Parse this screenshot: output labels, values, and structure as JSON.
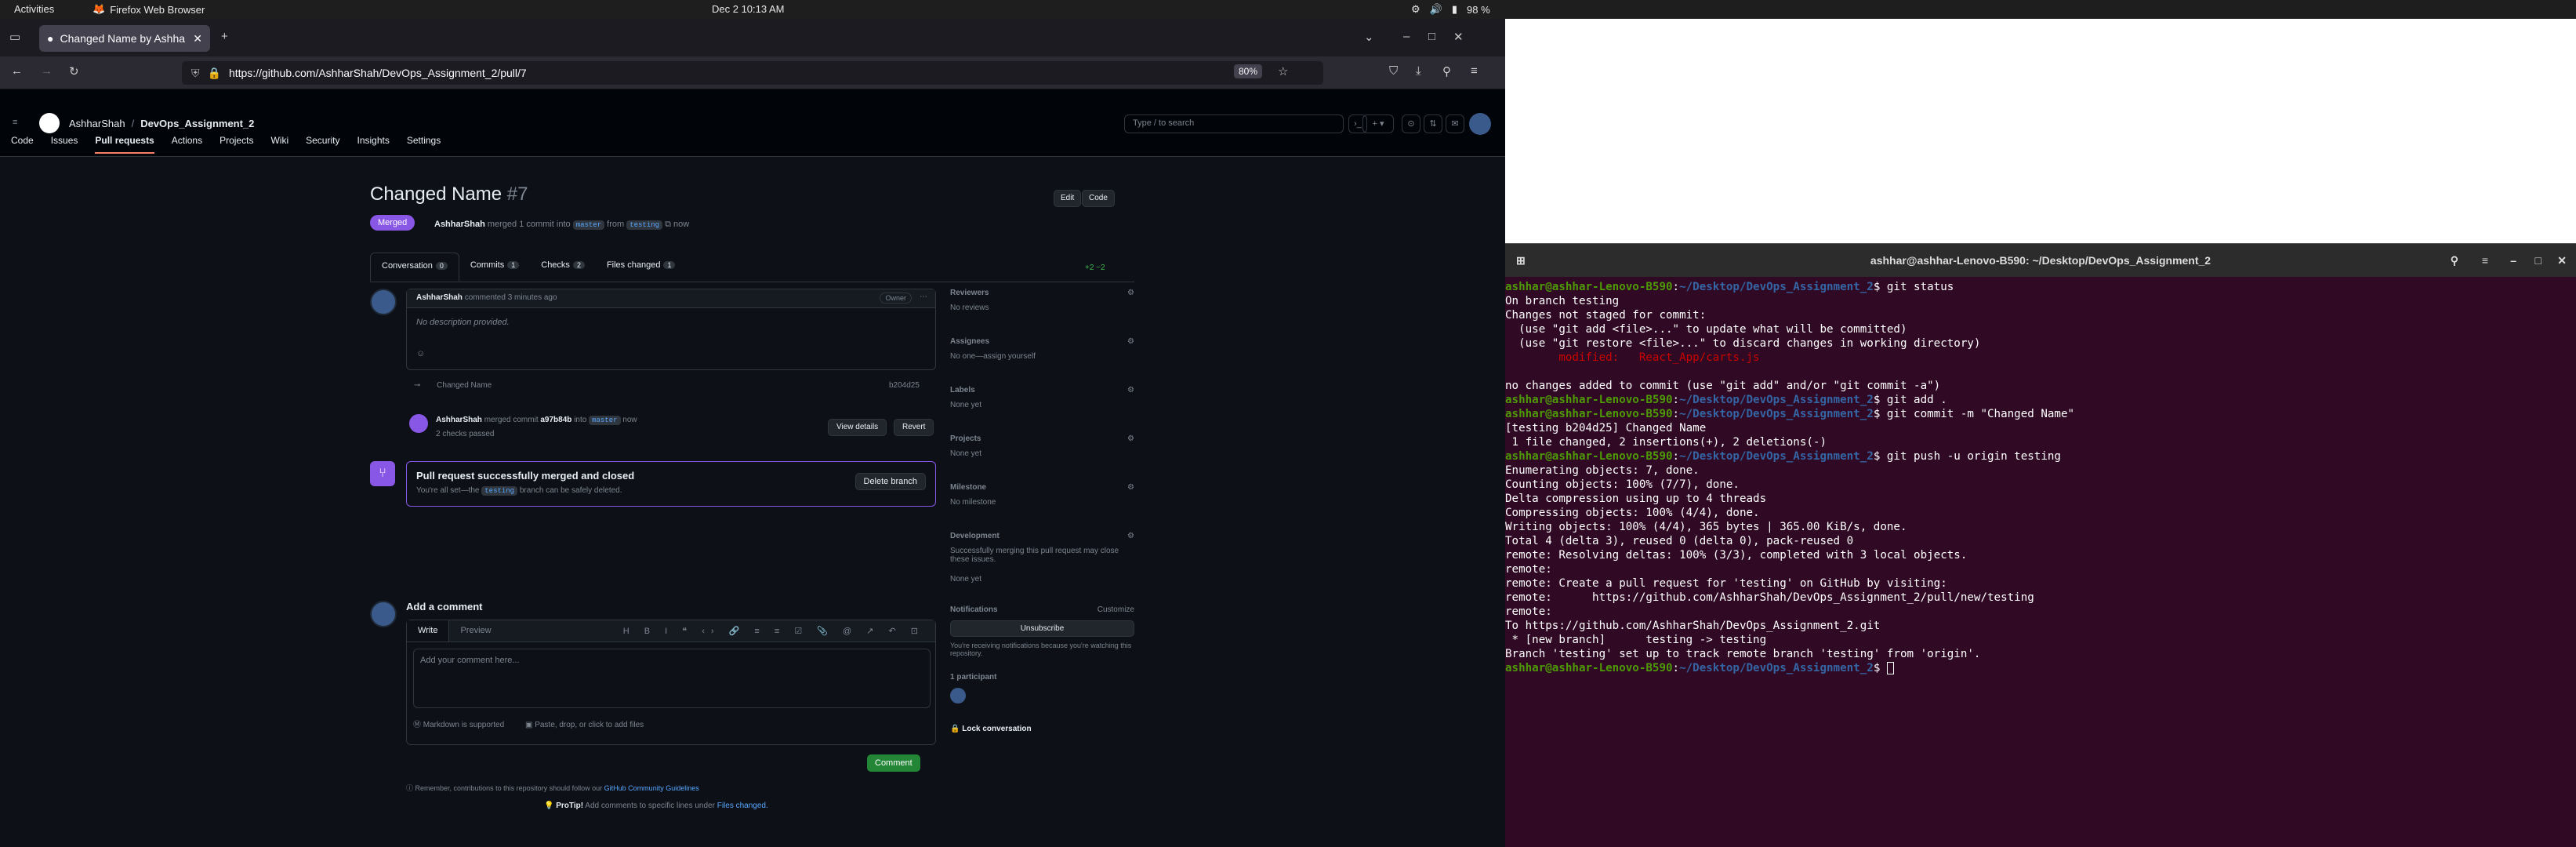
{
  "topbar": {
    "activities": "Activities",
    "app": "Firefox Web Browser",
    "clock": "Dec 2  10:13 AM",
    "battery": "98 %"
  },
  "browser": {
    "tab_title": "Changed Name by Ashha",
    "url": "https://github.com/AshharShah/DevOps_Assignment_2/pull/7",
    "zoom": "80%"
  },
  "gh": {
    "owner": "AshharShah",
    "repo": "DevOps_Assignment_2",
    "search_placeholder": "Type / to search",
    "nav": [
      "Code",
      "Issues",
      "Pull requests",
      "Actions",
      "Projects",
      "Wiki",
      "Security",
      "Insights",
      "Settings"
    ],
    "pr_title": "Changed Name",
    "pr_num": "#7",
    "edit": "Edit",
    "code_btn": "Code",
    "state": "Merged",
    "meta_user": "AshharShah",
    "meta_text": "merged 1 commit into",
    "base": "master",
    "meta_from": "from",
    "head": "testing",
    "meta_when": "now",
    "tabs": [
      {
        "label": "Conversation",
        "count": "0"
      },
      {
        "label": "Commits",
        "count": "1"
      },
      {
        "label": "Checks",
        "count": "2"
      },
      {
        "label": "Files changed",
        "count": "1"
      }
    ],
    "diffstat": "+2 −2",
    "comment_user": "AshharShah",
    "comment_when": "commented 3 minutes ago",
    "owner_badge": "Owner",
    "comment_body": "No description provided.",
    "commit_msg": "Changed Name",
    "commit_sha": "b204d25",
    "merge_event_user": "AshharShah",
    "merge_event_text": "merged commit",
    "merge_sha": "a97b84b",
    "merge_into": "into",
    "merge_base": "master",
    "merge_when": "now",
    "checks": "2 checks passed",
    "view_details": "View details",
    "revert": "Revert",
    "merged_title": "Pull request successfully merged and closed",
    "merged_sub": "You're all set—the",
    "merged_branch": "testing",
    "merged_sub2": "branch can be safely deleted.",
    "delete_branch": "Delete branch",
    "add_comment": "Add a comment",
    "write": "Write",
    "preview": "Preview",
    "comment_placeholder": "Add your comment here...",
    "markdown": "Markdown is supported",
    "paste": "Paste, drop, or click to add files",
    "comment_btn": "Comment",
    "reminder": "Remember, contributions to this repository should follow our",
    "guidelines": "GitHub Community Guidelines",
    "protip": "ProTip!",
    "protip_text": "Add comments to specific lines under",
    "files_changed": "Files changed.",
    "side": {
      "reviewers": "Reviewers",
      "no_reviews": "No reviews",
      "assignees": "Assignees",
      "no_one": "No one—assign yourself",
      "labels": "Labels",
      "none_yet": "None yet",
      "projects": "Projects",
      "milestone": "Milestone",
      "no_milestone": "No milestone",
      "development": "Development",
      "dev_text": "Successfully merging this pull request may close these issues.",
      "notifications": "Notifications",
      "customize": "Customize",
      "unsubscribe": "Unsubscribe",
      "notif_text": "You're receiving notifications because you're watching this repository.",
      "participants": "1 participant",
      "lock": "Lock conversation"
    }
  },
  "terminal": {
    "title": "ashhar@ashhar-Lenovo-B590: ~/Desktop/DevOps_Assignment_2",
    "user": "ashhar@ashhar-Lenovo-B590",
    "path": "~/Desktop/DevOps_Assignment_2",
    "lines": [
      {
        "p": true,
        "cmd": "git status"
      },
      {
        "t": "On branch testing"
      },
      {
        "t": "Changes not staged for commit:"
      },
      {
        "t": "  (use \"git add <file>...\" to update what will be committed)"
      },
      {
        "t": "  (use \"git restore <file>...\" to discard changes in working directory)"
      },
      {
        "t": "\tmodified:   React_App/carts.js",
        "red": true
      },
      {
        "t": ""
      },
      {
        "t": "no changes added to commit (use \"git add\" and/or \"git commit -a\")"
      },
      {
        "p": true,
        "cmd": "git add ."
      },
      {
        "p": true,
        "cmd": "git commit -m \"Changed Name\""
      },
      {
        "t": "[testing b204d25] Changed Name"
      },
      {
        "t": " 1 file changed, 2 insertions(+), 2 deletions(-)"
      },
      {
        "p": true,
        "cmd": "git push -u origin testing"
      },
      {
        "t": "Enumerating objects: 7, done."
      },
      {
        "t": "Counting objects: 100% (7/7), done."
      },
      {
        "t": "Delta compression using up to 4 threads"
      },
      {
        "t": "Compressing objects: 100% (4/4), done."
      },
      {
        "t": "Writing objects: 100% (4/4), 365 bytes | 365.00 KiB/s, done."
      },
      {
        "t": "Total 4 (delta 3), reused 0 (delta 0), pack-reused 0"
      },
      {
        "t": "remote: Resolving deltas: 100% (3/3), completed with 3 local objects."
      },
      {
        "t": "remote:"
      },
      {
        "t": "remote: Create a pull request for 'testing' on GitHub by visiting:"
      },
      {
        "t": "remote:      https://github.com/AshharShah/DevOps_Assignment_2/pull/new/testing"
      },
      {
        "t": "remote:"
      },
      {
        "t": "To https://github.com/AshharShah/DevOps_Assignment_2.git"
      },
      {
        "t": " * [new branch]      testing -> testing"
      },
      {
        "t": "Branch 'testing' set up to track remote branch 'testing' from 'origin'."
      },
      {
        "p": true,
        "cmd": ""
      }
    ]
  }
}
